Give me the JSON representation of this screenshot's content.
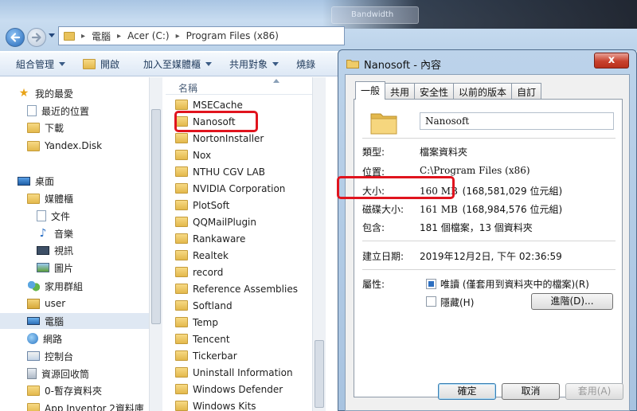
{
  "explorer": {
    "background_tab": "Bandwidth",
    "address": [
      "電腦",
      "Acer (C:)",
      "Program Files (x86)"
    ],
    "toolbar": [
      "組合管理",
      "開啟",
      "加入至媒體櫃",
      "共用對象",
      "燒錄"
    ],
    "nav_items": [
      {
        "label": "我的最愛",
        "icon": "star-icon"
      },
      {
        "label": "最近的位置",
        "icon": "recent-places-icon"
      },
      {
        "label": "下載",
        "icon": "downloads-folder-icon"
      },
      {
        "label": "Yandex.Disk",
        "icon": "folder-icon"
      },
      {
        "label": "桌面",
        "icon": "desktop-icon"
      },
      {
        "label": "媒體櫃",
        "icon": "libraries-icon"
      },
      {
        "label": "文件",
        "icon": "documents-icon"
      },
      {
        "label": "音樂",
        "icon": "music-icon"
      },
      {
        "label": "視訊",
        "icon": "videos-icon"
      },
      {
        "label": "圖片",
        "icon": "pictures-icon"
      },
      {
        "label": "家用群組",
        "icon": "homegroup-icon"
      },
      {
        "label": "user",
        "icon": "user-folder-icon"
      },
      {
        "label": "電腦",
        "icon": "computer-icon"
      },
      {
        "label": "網路",
        "icon": "network-icon"
      },
      {
        "label": "控制台",
        "icon": "control-panel-icon"
      },
      {
        "label": "資源回收筒",
        "icon": "recycle-bin-icon"
      },
      {
        "label": "0-暫存資料夾",
        "icon": "folder-icon"
      },
      {
        "label": "App Inventor 2資料庫",
        "icon": "folder-icon"
      }
    ],
    "column_header": "名稱",
    "files": [
      "MSECache",
      "Nanosoft",
      "NortonInstaller",
      "Nox",
      "NTHU CGV LAB",
      "NVIDIA Corporation",
      "PlotSoft",
      "QQMailPlugin",
      "Rankaware",
      "Realtek",
      "record",
      "Reference Assemblies",
      "Softland",
      "Temp",
      "Tencent",
      "Tickerbar",
      "Uninstall Information",
      "Windows Defender",
      "Windows Kits"
    ]
  },
  "dialog": {
    "title": "Nanosoft - 內容",
    "close_glyph": "x",
    "tabs": [
      "一般",
      "共用",
      "安全性",
      "以前的版本",
      "自訂"
    ],
    "folder_name": "Nanosoft",
    "type_label": "類型:",
    "type_value": "檔案資料夾",
    "location_label": "位置:",
    "location_value": "C:\\Program Files (x86)",
    "size_label": "大小:",
    "size_value": "160 MB",
    "size_bytes": "(168,581,029 位元組)",
    "disk_size_label": "磁碟大小:",
    "disk_size_value": "161 MB",
    "disk_size_bytes": "(168,984,576 位元組)",
    "contains_label": "包含:",
    "contains_value": "181 個檔案，13 個資料夾",
    "created_label": "建立日期:",
    "created_value": "2019年12月2日, 下午 02:36:59",
    "attributes_label": "屬性:",
    "readonly_label": "唯讀 (僅套用到資料夾中的檔案)(R)",
    "readonly_checked": true,
    "hidden_label": "隱藏(H)",
    "hidden_checked": false,
    "advanced_button": "進階(D)...",
    "ok_button": "確定",
    "cancel_button": "取消",
    "apply_button": "套用(A)"
  },
  "colors": {
    "highlight_red": "#e0141e",
    "glass_blue": "#bcd3ea"
  }
}
